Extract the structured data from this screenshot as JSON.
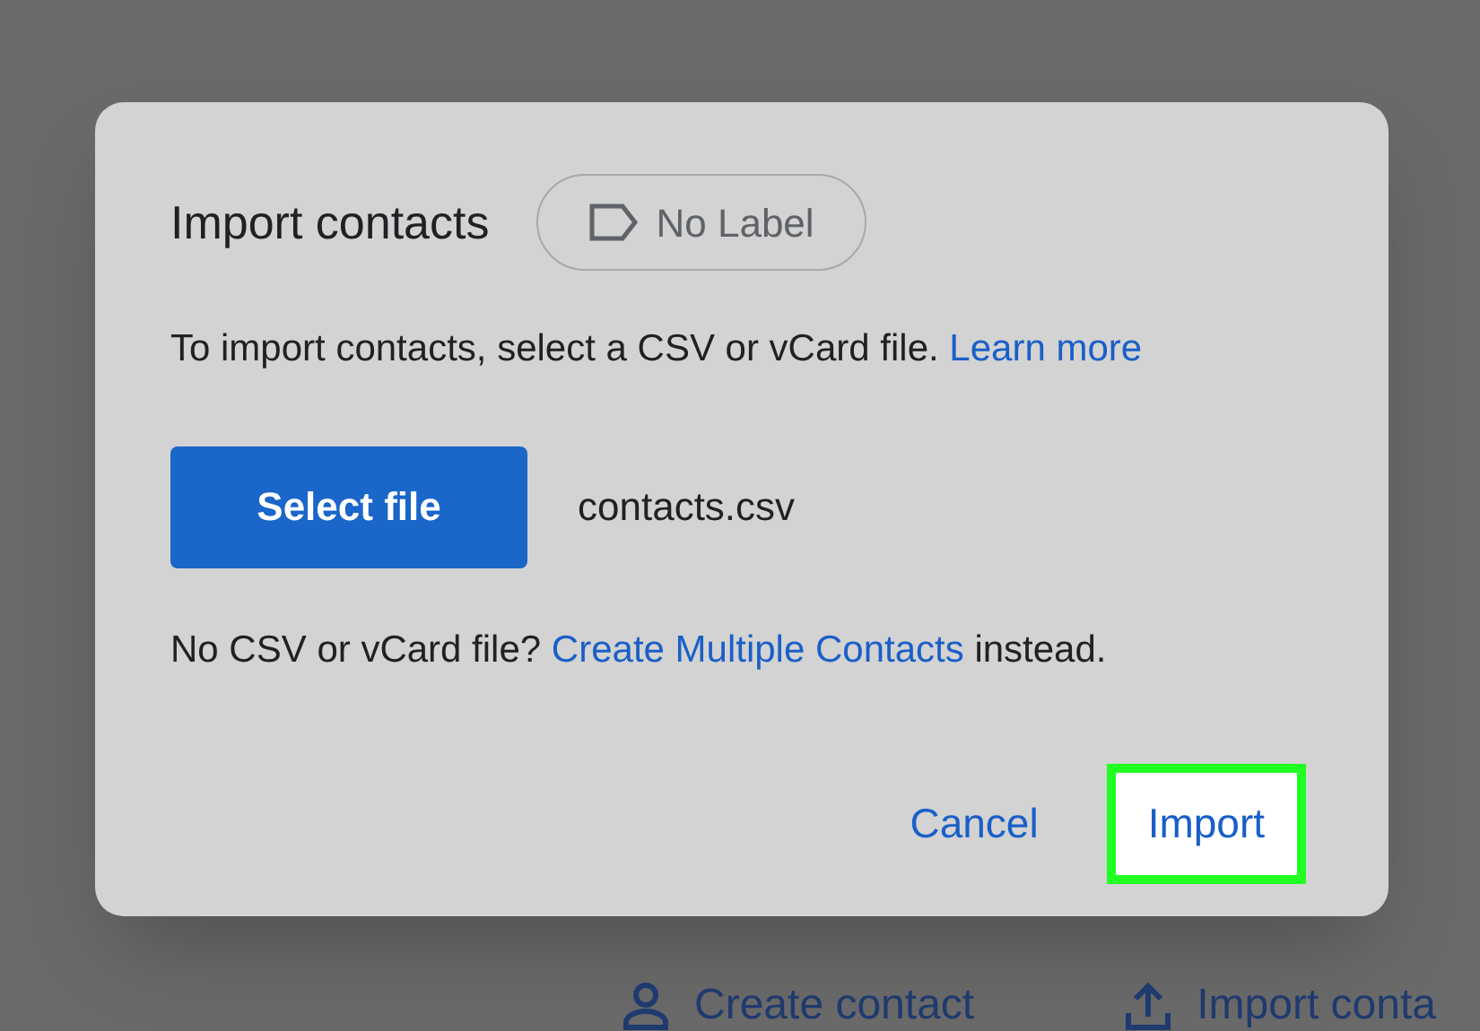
{
  "dialog": {
    "title": "Import contacts",
    "label_chip": "No Label",
    "description": {
      "text": "To import contacts, select a CSV or vCard file.",
      "link": "Learn more"
    },
    "select_button": "Select file",
    "file_name": "contacts.csv",
    "hint": {
      "before": "No CSV or vCard file?",
      "link": "Create Multiple Contacts",
      "after": "instead."
    },
    "buttons": [
      {
        "label": "Cancel",
        "highlighted": false
      },
      {
        "label": "Import",
        "highlighted": true
      }
    ]
  },
  "background_actions": [
    {
      "kind": "person",
      "label": "Create contact"
    },
    {
      "kind": "upload",
      "label": "Import conta"
    }
  ]
}
